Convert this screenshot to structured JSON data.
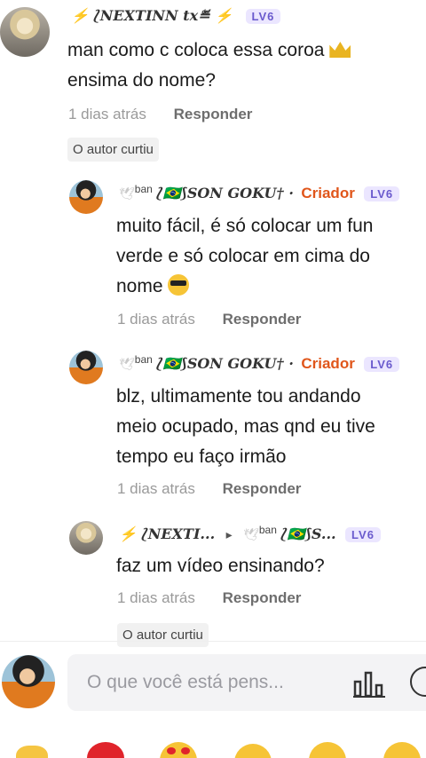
{
  "comments": [
    {
      "user": "⚡ ⟅NEXTINN tx≝ ⚡",
      "level": "LV6",
      "lines": [
        "man como c coloca essa coroa",
        "ensima do nome?"
      ],
      "time": "1 dias atrás",
      "reply": "Responder",
      "liked": "O autor curtiu"
    },
    {
      "user_prefix": "ban",
      "user": "⟅🇧🇷⟆SON GOKU† ·",
      "badge": "Criador",
      "level": "LV6",
      "lines": [
        "muito fácil, é só colocar um fun",
        "verde e só colocar em cima do",
        "nome"
      ],
      "time": "1 dias atrás",
      "reply": "Responder"
    },
    {
      "user_prefix": "ban",
      "user": "⟅🇧🇷⟆SON GOKU† ·",
      "badge": "Criador",
      "level": "LV6",
      "lines": [
        "blz, ultimamente tou andando",
        "meio ocupado, mas qnd eu tive",
        "tempo eu faço irmão"
      ],
      "time": "1 dias atrás",
      "reply": "Responder"
    },
    {
      "user": "⚡ ⟅NEXTI...",
      "arrow": "▸",
      "reply_to_prefix": "ban",
      "reply_to": "⟅🇧🇷⟆S...",
      "level": "LV6",
      "lines": [
        "faz um vídeo ensinando?"
      ],
      "time": "1 dias atrás",
      "reply": "Responder",
      "liked": "O autor curtiu"
    }
  ],
  "composer": {
    "placeholder": "O que você está pens..."
  },
  "icons": [
    "chart-icon",
    "gif-icon",
    "hands-emoji",
    "heart-emoji",
    "heart-eyes-emoji",
    "smile-emoji",
    "wink-emoji",
    "grin-emoji"
  ]
}
